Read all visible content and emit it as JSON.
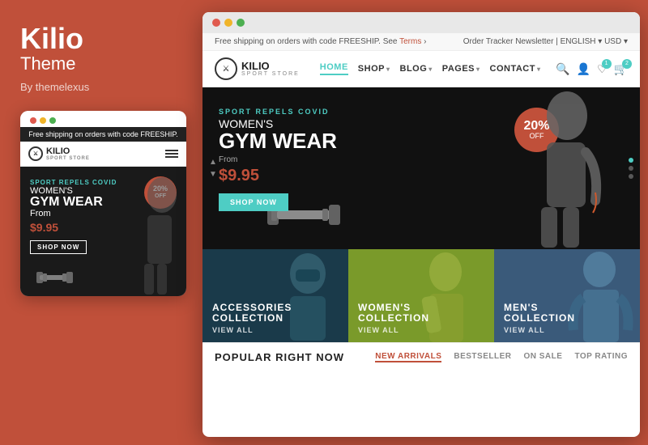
{
  "leftPanel": {
    "brandName": "Kilio",
    "brandSubtitle": "Theme",
    "brandBy": "By themelexus"
  },
  "mobileMockup": {
    "announcement": "Free shipping on orders with code FREESHIP.",
    "logoText": "KILIO",
    "logoSub": "SPORT STORE",
    "badge20": "20%",
    "badgeOff": "OFF",
    "heroEyebrow": "SPORT REPELS COVID",
    "heroTitle1": "WOMEN'S",
    "heroTitle2": "GYM WEAR",
    "heroFrom": "From",
    "heroPrice": "$9.95",
    "shopNow": "SHOP NOW"
  },
  "desktopMockup": {
    "announcement": "Free shipping on orders with code FREESHIP. See Terms ›",
    "announcementRight": "Order Tracker   Newsletter  |  ENGLISH ▾   USD ▾",
    "logoText": "KILIO",
    "logoSub": "SPORT STORE",
    "nav": {
      "home": "HOME",
      "shop": "SHOP",
      "blog": "BLOG",
      "pages": "PAGES",
      "contact": "CONTACT"
    },
    "hero": {
      "eyebrow": "SPORT REPELS COVID",
      "title1": "WOMEN'S",
      "title2": "GYM WEAR",
      "from": "From",
      "price": "$9.95",
      "shopNow": "SHOP NOW",
      "badge20": "20%",
      "badgeOff": "OFF"
    },
    "collections": [
      {
        "label": "ACCESSORIES\nCOLLECTION",
        "link": "VIEW ALL",
        "bgColor": "#2a4a5a"
      },
      {
        "label": "WOMEN'S\nCOLLECTION",
        "link": "VIEW ALL",
        "bgColor": "#8aaa30"
      },
      {
        "label": "MEN'S\nCOLLECTION",
        "link": "VIEW ALL",
        "bgColor": "#4a6a8a"
      }
    ],
    "popularTitle": "POPULAR RIGHT NOW",
    "popularTabs": [
      "NEW ARRIVALS",
      "BESTSELLER",
      "ON SALE",
      "TOP RATING"
    ]
  }
}
